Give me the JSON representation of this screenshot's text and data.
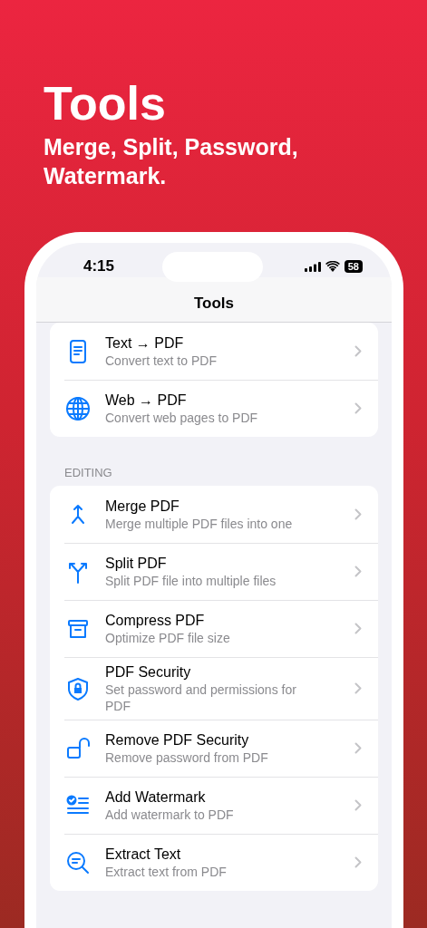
{
  "hero": {
    "title": "Tools",
    "subtitle": "Merge, Split, Password, Watermark."
  },
  "status_bar": {
    "time": "4:15",
    "battery": "58"
  },
  "nav": {
    "title": "Tools"
  },
  "sections": [
    {
      "items": [
        {
          "title": "Text → PDF",
          "subtitle": "Convert text to PDF"
        },
        {
          "title": "Web → PDF",
          "subtitle": "Convert web pages to PDF"
        }
      ]
    },
    {
      "header": "EDITING",
      "items": [
        {
          "title": "Merge PDF",
          "subtitle": "Merge multiple PDF files into one"
        },
        {
          "title": "Split PDF",
          "subtitle": "Split PDF file into multiple files"
        },
        {
          "title": "Compress PDF",
          "subtitle": "Optimize PDF file size"
        },
        {
          "title": "PDF Security",
          "subtitle": "Set password and permissions for PDF"
        },
        {
          "title": "Remove PDF Security",
          "subtitle": "Remove password from PDF"
        },
        {
          "title": "Add Watermark",
          "subtitle": "Add watermark to PDF"
        },
        {
          "title": "Extract Text",
          "subtitle": "Extract text from PDF"
        }
      ]
    }
  ]
}
